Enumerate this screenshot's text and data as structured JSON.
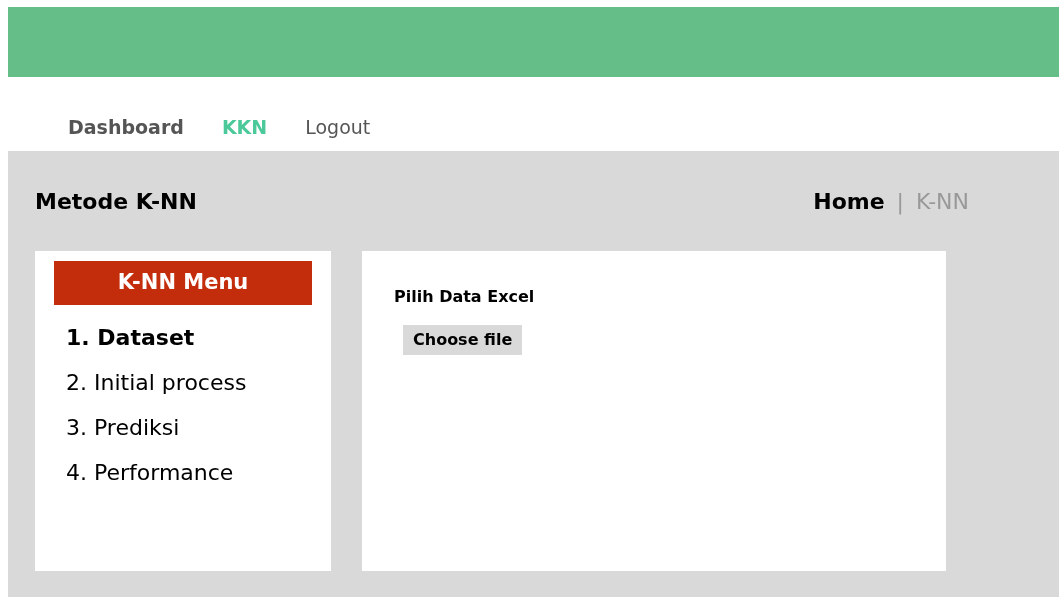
{
  "nav": [
    {
      "label": "Dashboard",
      "selected": false
    },
    {
      "label": "KKN",
      "selected": true
    },
    {
      "label": "Logout",
      "selected": false
    }
  ],
  "page_title": "Metode K-NN",
  "breadcrumb": {
    "items": [
      "Home",
      "K-NN"
    ],
    "separator": "|"
  },
  "menu": {
    "title": "K-NN Menu",
    "items": [
      {
        "label": "1. Dataset",
        "selected": true
      },
      {
        "label": "2. Initial process",
        "selected": false
      },
      {
        "label": "3. Prediksi",
        "selected": false
      },
      {
        "label": "4. Performance",
        "selected": false
      }
    ]
  },
  "upload": {
    "label": "Pilih Data Excel",
    "button": "Choose file"
  }
}
